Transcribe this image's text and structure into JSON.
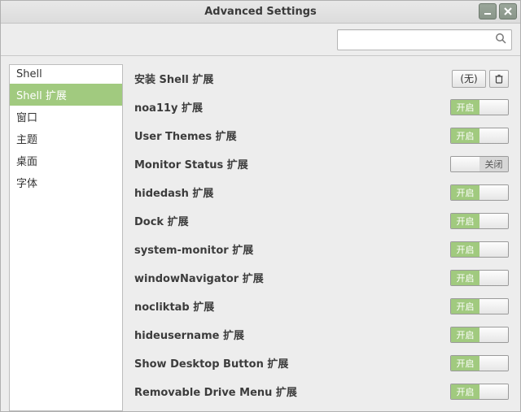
{
  "window": {
    "title": "Advanced Settings"
  },
  "search": {
    "value": "",
    "placeholder": ""
  },
  "sidebar": {
    "items": [
      {
        "label": "Shell",
        "selected": false
      },
      {
        "label": "Shell 扩展",
        "selected": true
      },
      {
        "label": "窗口",
        "selected": false
      },
      {
        "label": "主题",
        "selected": false
      },
      {
        "label": "桌面",
        "selected": false
      },
      {
        "label": "字体",
        "selected": false
      }
    ]
  },
  "toggle_labels": {
    "on": "开启",
    "off": "关闭"
  },
  "install_row": {
    "label": "安装 Shell 扩展",
    "combo_value": "(无)"
  },
  "extensions": [
    {
      "label": "noa11y 扩展",
      "state": "on"
    },
    {
      "label": "User Themes 扩展",
      "state": "on"
    },
    {
      "label": "Monitor Status 扩展",
      "state": "off"
    },
    {
      "label": "hidedash 扩展",
      "state": "on"
    },
    {
      "label": "Dock 扩展",
      "state": "on"
    },
    {
      "label": "system-monitor 扩展",
      "state": "on"
    },
    {
      "label": "windowNavigator 扩展",
      "state": "on"
    },
    {
      "label": "nocliktab 扩展",
      "state": "on"
    },
    {
      "label": "hideusername 扩展",
      "state": "on"
    },
    {
      "label": "Show Desktop Button 扩展",
      "state": "on"
    },
    {
      "label": "Removable Drive Menu 扩展",
      "state": "on"
    }
  ]
}
